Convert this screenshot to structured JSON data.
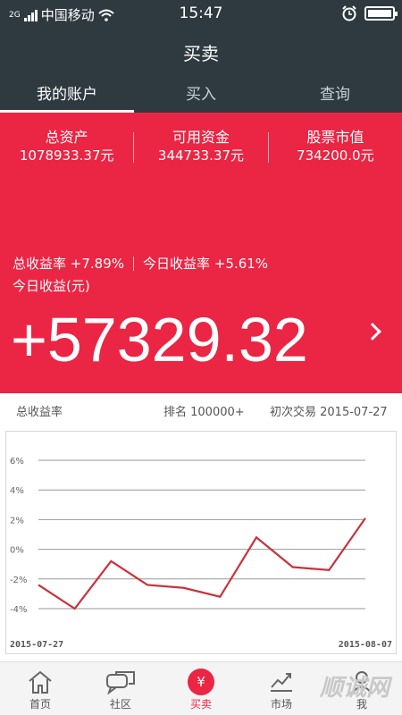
{
  "status_bar": {
    "network": "2G",
    "carrier": "中国移动",
    "time": "15:47"
  },
  "nav": {
    "title": "买卖",
    "tabs": [
      {
        "label": "我的账户",
        "active": true
      },
      {
        "label": "买入",
        "active": false
      },
      {
        "label": "查询",
        "active": false
      }
    ]
  },
  "account": {
    "total_assets_label": "总资产",
    "total_assets": "1078933.37元",
    "available_funds_label": "可用资金",
    "available_funds": "344733.37元",
    "stock_value_label": "股票市值",
    "stock_value": "734200.0元",
    "total_return_label": "总收益率",
    "total_return": "+7.89%",
    "today_return_label": "今日收益率",
    "today_return": "+5.61%",
    "today_profit_label": "今日收益(元)",
    "today_profit": "+57329.32"
  },
  "info": {
    "chart_label": "总收益率",
    "rank": "排名 100000+",
    "first_trade": "初次交易 2015-07-27"
  },
  "chart_data": {
    "type": "line",
    "x_start_label": "2015-07-27",
    "x_end_label": "2015-08-07",
    "yticks": [
      "6%",
      "4%",
      "2%",
      "0%",
      "-2%",
      "-4%"
    ],
    "ylim": [
      -4,
      6
    ],
    "series": [
      {
        "values": [
          -2.4,
          -4.0,
          -0.8,
          -2.4,
          -2.6,
          -3.2,
          0.8,
          -1.2,
          -1.4,
          2.1
        ]
      }
    ],
    "line_color": "#c8333a"
  },
  "bottom_nav": [
    {
      "label": "首页",
      "icon": "home-icon",
      "active": false
    },
    {
      "label": "社区",
      "icon": "chat-icon",
      "active": false
    },
    {
      "label": "买卖",
      "icon": "yuan-icon",
      "active": true,
      "glyph": "¥"
    },
    {
      "label": "市场",
      "icon": "market-icon",
      "active": false
    },
    {
      "label": "我",
      "icon": "user-icon",
      "active": false
    }
  ],
  "watermark": "顺诚网"
}
